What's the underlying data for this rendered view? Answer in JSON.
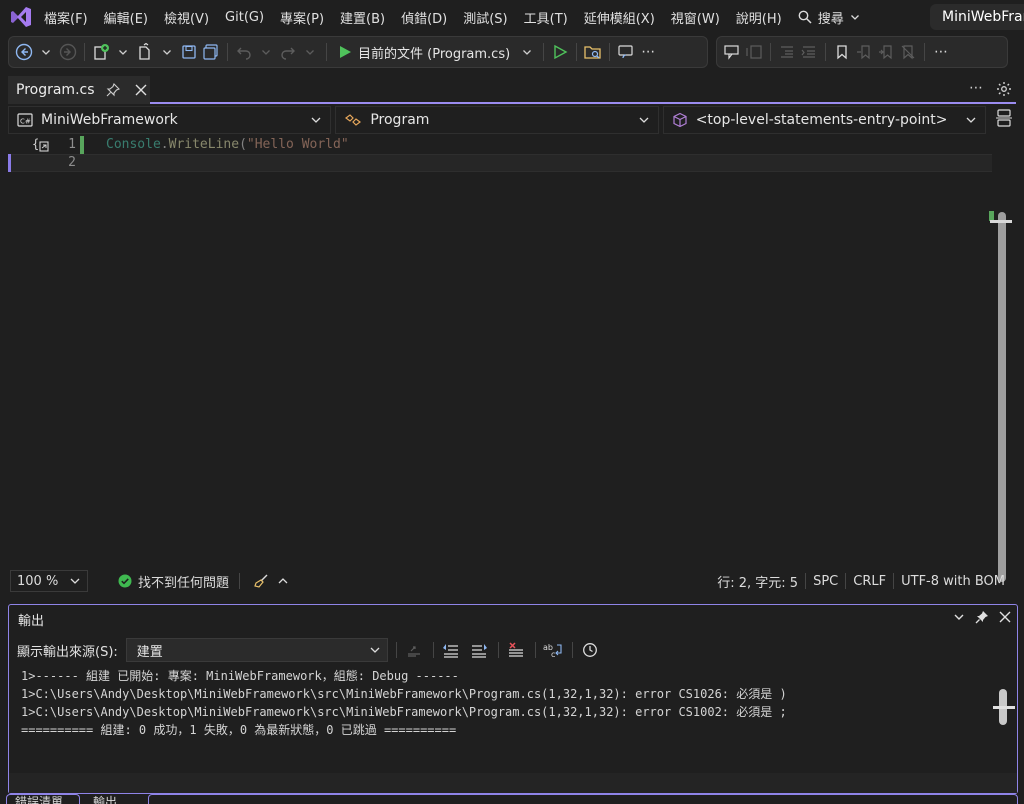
{
  "menubar": {
    "items": [
      "檔案(F)",
      "編輯(E)",
      "檢視(V)",
      "Git(G)",
      "專案(P)",
      "建置(B)",
      "偵錯(D)",
      "測試(S)",
      "工具(T)",
      "延伸模組(X)",
      "視窗(W)",
      "說明(H)"
    ],
    "search_label": "搜尋",
    "solution_title": "MiniWebFramework"
  },
  "toolbar": {
    "run_target": "目前的文件 (Program.cs)",
    "overflow_label": "⋯"
  },
  "editor": {
    "tab": {
      "label": "Program.cs"
    },
    "navbar": {
      "project": "MiniWebFramework",
      "type": "Program",
      "member": "<top-level-statements-entry-point>"
    },
    "lines": {
      "n1": "1",
      "n2": "2",
      "code1": {
        "ident": "Console",
        "dot": ".",
        "method": "WriteLine",
        "paren": "(",
        "string": "\"Hello World\""
      }
    },
    "status": {
      "zoom": "100 %",
      "issues": "找不到任何問題",
      "position": "行: 2, 字元: 5",
      "spacing": "SPC",
      "line_ending": "CRLF",
      "encoding": "UTF-8 with BOM"
    }
  },
  "output": {
    "title": "輸出",
    "source_label": "顯示輸出來源(S):",
    "source_value": "建置",
    "lines": [
      "1>------ 組建 已開始: 專案: MiniWebFramework，組態: Debug ------",
      "1>C:\\Users\\Andy\\Desktop\\MiniWebFramework\\src\\MiniWebFramework\\Program.cs(1,32,1,32): error CS1026: 必須是 )",
      "1>C:\\Users\\Andy\\Desktop\\MiniWebFramework\\src\\MiniWebFramework\\Program.cs(1,32,1,32): error CS1002: 必須是 ;",
      "========== 組建: 0 成功，1 失敗，0 為最新狀態，0 已跳過 =========="
    ]
  },
  "bottom_tabs": [
    "錯誤清單",
    "輸出"
  ],
  "colors": {
    "accent": "#9b8cf0",
    "run_green": "#4fc25b",
    "error_red": "#e8525a",
    "issues_ok": "#3fb950"
  }
}
